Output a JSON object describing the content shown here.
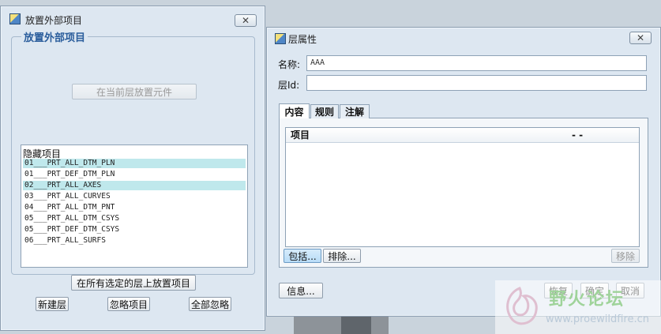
{
  "left_dialog": {
    "title": "放置外部项目",
    "close_label": "✕",
    "group_title": "放置外部项目",
    "place_in_current_layer": "在当前层放置元件",
    "hidden_list": {
      "header": "隐藏项目",
      "items": [
        {
          "text": "01___PRT_ALL_DTM_PLN",
          "selected": true
        },
        {
          "text": "01___PRT_DEF_DTM_PLN",
          "selected": false
        },
        {
          "text": "02___PRT_ALL_AXES",
          "selected": true
        },
        {
          "text": "03___PRT_ALL_CURVES",
          "selected": false
        },
        {
          "text": "04___PRT_ALL_DTM_PNT",
          "selected": false
        },
        {
          "text": "05___PRT_ALL_DTM_CSYS",
          "selected": false
        },
        {
          "text": "05___PRT_DEF_DTM_CSYS",
          "selected": false
        },
        {
          "text": "06___PRT_ALL_SURFS",
          "selected": false
        }
      ]
    },
    "place_on_selected_layers": "在所有选定的层上放置项目",
    "new_layer": "新建层",
    "ignore_item": "忽略项目",
    "ignore_all": "全部忽略"
  },
  "right_dialog": {
    "title": "层属性",
    "close_label": "✕",
    "name_label": "名称:",
    "name_value": "AAA",
    "layer_id_label": "层Id:",
    "layer_id_value": "",
    "tabs": [
      "内容",
      "规则",
      "注解"
    ],
    "table_headers": [
      "项目",
      "- -"
    ],
    "include": "包括...",
    "exclude": "排除...",
    "remove": "移除",
    "info": "信息...",
    "restore": "恢复",
    "ok": "确定",
    "cancel": "取消"
  },
  "watermark": {
    "text": "野火论坛",
    "url": "www.proewildfire.cn"
  }
}
